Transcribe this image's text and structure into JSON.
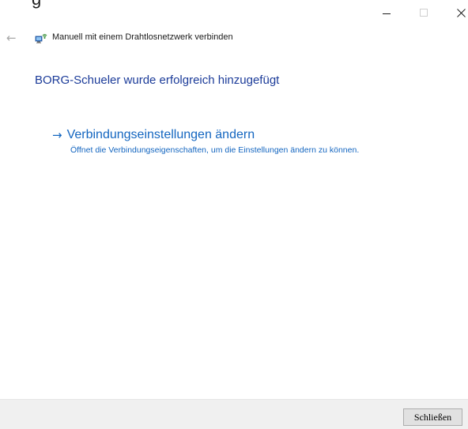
{
  "window": {
    "clipped_title_fragment": "...g...",
    "minimize_glyph": "—",
    "maximize_glyph": "□",
    "close_glyph": "✕"
  },
  "header": {
    "back_glyph": "←",
    "icon": "wireless-network-icon",
    "title": "Manuell mit einem Drahtlosnetzwerk verbinden"
  },
  "main": {
    "success_message": "BORG-Schueler wurde erfolgreich hinzugefügt",
    "link": {
      "arrow_glyph": "→",
      "title": "Verbindungseinstellungen ändern",
      "description": "Öffnet die Verbindungseigenschaften, um die Einstellungen ändern zu können."
    }
  },
  "footer": {
    "close_label": "Schließen"
  },
  "colors": {
    "heading": "#1b3b99",
    "link": "#1466c0",
    "footer_bg": "#f0f0f0"
  }
}
